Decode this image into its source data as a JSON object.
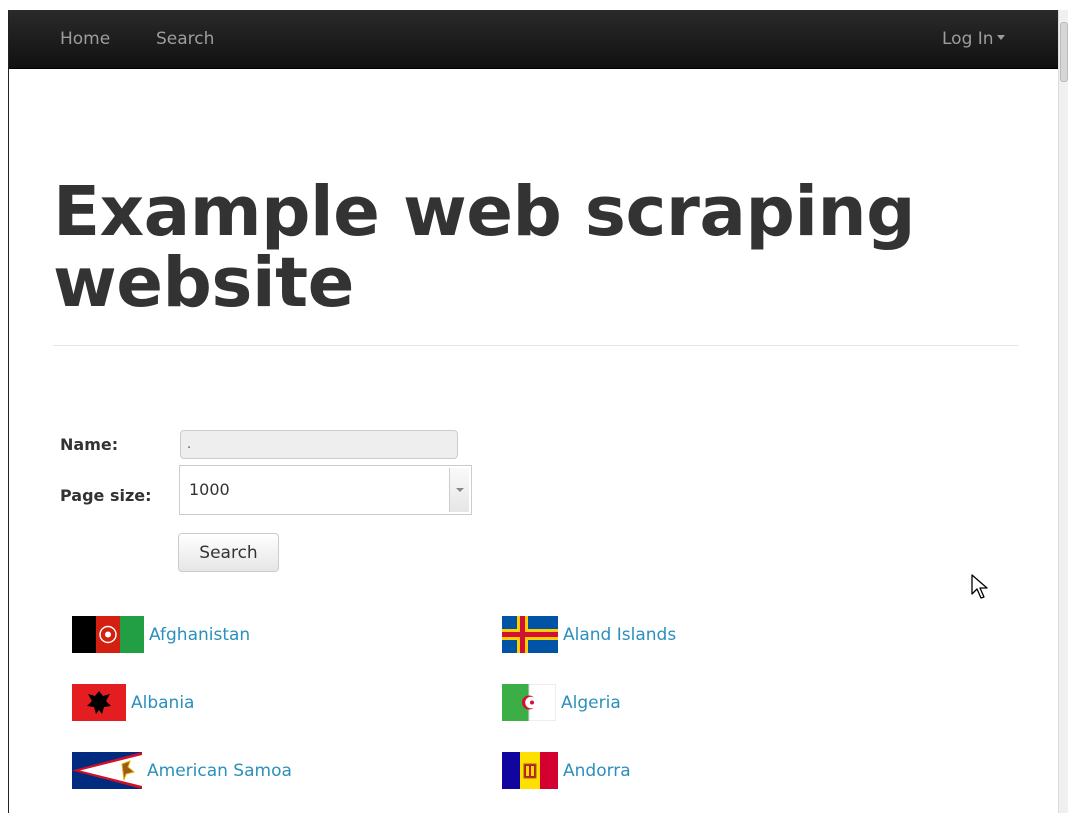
{
  "nav": {
    "home": "Home",
    "search": "Search",
    "login": "Log In"
  },
  "heading": "Example web scraping website",
  "form": {
    "name_label": "Name:",
    "name_value": ".",
    "page_size_label": "Page size:",
    "page_size_value": "1000",
    "search_button": "Search"
  },
  "countries": [
    {
      "name": "Afghanistan",
      "flag": "afghanistan-flag-icon"
    },
    {
      "name": "Aland Islands",
      "flag": "aland-islands-flag-icon"
    },
    {
      "name": "Albania",
      "flag": "albania-flag-icon"
    },
    {
      "name": "Algeria",
      "flag": "algeria-flag-icon"
    },
    {
      "name": "American Samoa",
      "flag": "american-samoa-flag-icon"
    },
    {
      "name": "Andorra",
      "flag": "andorra-flag-icon"
    }
  ],
  "colors": {
    "navbar": "#1b1b1b",
    "nav_text": "#9d9d9d",
    "link": "#2a8fbd",
    "heading": "#333333"
  }
}
